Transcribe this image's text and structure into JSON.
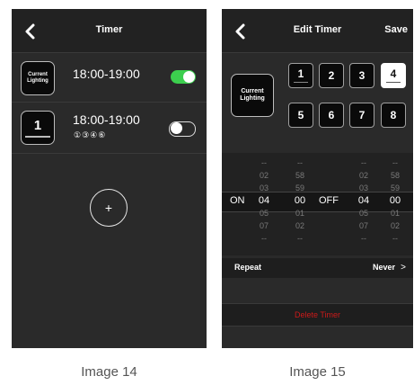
{
  "screen14": {
    "title": "Timer",
    "timers": [
      {
        "icon_label": "Current\nLighting",
        "time": "18:00-19:00",
        "enabled": true
      },
      {
        "icon_number": "1",
        "time": "18:00-19:00",
        "days": "①③④⑥",
        "enabled": false
      }
    ],
    "add_symbol": "+",
    "caption": "Image 14"
  },
  "screen15": {
    "title": "Edit Timer",
    "save_label": "Save",
    "current_lighting": "Current\nLighting",
    "channels": [
      "1",
      "2",
      "3",
      "4",
      "5",
      "6",
      "7",
      "8"
    ],
    "selected_channel": "4",
    "picker": {
      "on_label": "ON",
      "off_label": "OFF",
      "on_hours": [
        "--",
        "02",
        "03",
        "04",
        "05",
        "07",
        "--"
      ],
      "on_minutes": [
        "--",
        "58",
        "59",
        "00",
        "01",
        "02",
        "--"
      ],
      "off_hours": [
        "--",
        "02",
        "03",
        "04",
        "05",
        "07",
        "--"
      ],
      "off_minutes": [
        "--",
        "58",
        "59",
        "00",
        "01",
        "02",
        "--"
      ]
    },
    "repeat_label": "Repeat",
    "repeat_value": "Never",
    "delete_label": "Delete Timer",
    "caption": "Image 15"
  },
  "colors": {
    "toggle_on": "#3ccf4e",
    "delete": "#cc1a1a",
    "screen_bg": "#2a2a2a"
  },
  "icons": [
    "back-chevron-icon",
    "plus-icon",
    "chevron-right-icon"
  ]
}
